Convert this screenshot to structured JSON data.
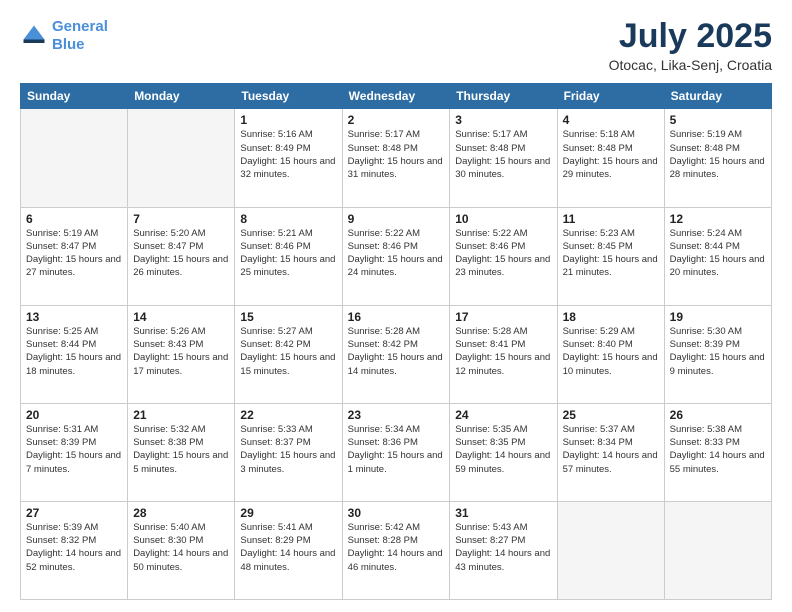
{
  "header": {
    "logo_line1": "General",
    "logo_line2": "Blue",
    "month": "July 2025",
    "location": "Otocac, Lika-Senj, Croatia"
  },
  "weekdays": [
    "Sunday",
    "Monday",
    "Tuesday",
    "Wednesday",
    "Thursday",
    "Friday",
    "Saturday"
  ],
  "weeks": [
    [
      {
        "day": "",
        "sunrise": "",
        "sunset": "",
        "daylight": ""
      },
      {
        "day": "",
        "sunrise": "",
        "sunset": "",
        "daylight": ""
      },
      {
        "day": "1",
        "sunrise": "Sunrise: 5:16 AM",
        "sunset": "Sunset: 8:49 PM",
        "daylight": "Daylight: 15 hours and 32 minutes."
      },
      {
        "day": "2",
        "sunrise": "Sunrise: 5:17 AM",
        "sunset": "Sunset: 8:48 PM",
        "daylight": "Daylight: 15 hours and 31 minutes."
      },
      {
        "day": "3",
        "sunrise": "Sunrise: 5:17 AM",
        "sunset": "Sunset: 8:48 PM",
        "daylight": "Daylight: 15 hours and 30 minutes."
      },
      {
        "day": "4",
        "sunrise": "Sunrise: 5:18 AM",
        "sunset": "Sunset: 8:48 PM",
        "daylight": "Daylight: 15 hours and 29 minutes."
      },
      {
        "day": "5",
        "sunrise": "Sunrise: 5:19 AM",
        "sunset": "Sunset: 8:48 PM",
        "daylight": "Daylight: 15 hours and 28 minutes."
      }
    ],
    [
      {
        "day": "6",
        "sunrise": "Sunrise: 5:19 AM",
        "sunset": "Sunset: 8:47 PM",
        "daylight": "Daylight: 15 hours and 27 minutes."
      },
      {
        "day": "7",
        "sunrise": "Sunrise: 5:20 AM",
        "sunset": "Sunset: 8:47 PM",
        "daylight": "Daylight: 15 hours and 26 minutes."
      },
      {
        "day": "8",
        "sunrise": "Sunrise: 5:21 AM",
        "sunset": "Sunset: 8:46 PM",
        "daylight": "Daylight: 15 hours and 25 minutes."
      },
      {
        "day": "9",
        "sunrise": "Sunrise: 5:22 AM",
        "sunset": "Sunset: 8:46 PM",
        "daylight": "Daylight: 15 hours and 24 minutes."
      },
      {
        "day": "10",
        "sunrise": "Sunrise: 5:22 AM",
        "sunset": "Sunset: 8:46 PM",
        "daylight": "Daylight: 15 hours and 23 minutes."
      },
      {
        "day": "11",
        "sunrise": "Sunrise: 5:23 AM",
        "sunset": "Sunset: 8:45 PM",
        "daylight": "Daylight: 15 hours and 21 minutes."
      },
      {
        "day": "12",
        "sunrise": "Sunrise: 5:24 AM",
        "sunset": "Sunset: 8:44 PM",
        "daylight": "Daylight: 15 hours and 20 minutes."
      }
    ],
    [
      {
        "day": "13",
        "sunrise": "Sunrise: 5:25 AM",
        "sunset": "Sunset: 8:44 PM",
        "daylight": "Daylight: 15 hours and 18 minutes."
      },
      {
        "day": "14",
        "sunrise": "Sunrise: 5:26 AM",
        "sunset": "Sunset: 8:43 PM",
        "daylight": "Daylight: 15 hours and 17 minutes."
      },
      {
        "day": "15",
        "sunrise": "Sunrise: 5:27 AM",
        "sunset": "Sunset: 8:42 PM",
        "daylight": "Daylight: 15 hours and 15 minutes."
      },
      {
        "day": "16",
        "sunrise": "Sunrise: 5:28 AM",
        "sunset": "Sunset: 8:42 PM",
        "daylight": "Daylight: 15 hours and 14 minutes."
      },
      {
        "day": "17",
        "sunrise": "Sunrise: 5:28 AM",
        "sunset": "Sunset: 8:41 PM",
        "daylight": "Daylight: 15 hours and 12 minutes."
      },
      {
        "day": "18",
        "sunrise": "Sunrise: 5:29 AM",
        "sunset": "Sunset: 8:40 PM",
        "daylight": "Daylight: 15 hours and 10 minutes."
      },
      {
        "day": "19",
        "sunrise": "Sunrise: 5:30 AM",
        "sunset": "Sunset: 8:39 PM",
        "daylight": "Daylight: 15 hours and 9 minutes."
      }
    ],
    [
      {
        "day": "20",
        "sunrise": "Sunrise: 5:31 AM",
        "sunset": "Sunset: 8:39 PM",
        "daylight": "Daylight: 15 hours and 7 minutes."
      },
      {
        "day": "21",
        "sunrise": "Sunrise: 5:32 AM",
        "sunset": "Sunset: 8:38 PM",
        "daylight": "Daylight: 15 hours and 5 minutes."
      },
      {
        "day": "22",
        "sunrise": "Sunrise: 5:33 AM",
        "sunset": "Sunset: 8:37 PM",
        "daylight": "Daylight: 15 hours and 3 minutes."
      },
      {
        "day": "23",
        "sunrise": "Sunrise: 5:34 AM",
        "sunset": "Sunset: 8:36 PM",
        "daylight": "Daylight: 15 hours and 1 minute."
      },
      {
        "day": "24",
        "sunrise": "Sunrise: 5:35 AM",
        "sunset": "Sunset: 8:35 PM",
        "daylight": "Daylight: 14 hours and 59 minutes."
      },
      {
        "day": "25",
        "sunrise": "Sunrise: 5:37 AM",
        "sunset": "Sunset: 8:34 PM",
        "daylight": "Daylight: 14 hours and 57 minutes."
      },
      {
        "day": "26",
        "sunrise": "Sunrise: 5:38 AM",
        "sunset": "Sunset: 8:33 PM",
        "daylight": "Daylight: 14 hours and 55 minutes."
      }
    ],
    [
      {
        "day": "27",
        "sunrise": "Sunrise: 5:39 AM",
        "sunset": "Sunset: 8:32 PM",
        "daylight": "Daylight: 14 hours and 52 minutes."
      },
      {
        "day": "28",
        "sunrise": "Sunrise: 5:40 AM",
        "sunset": "Sunset: 8:30 PM",
        "daylight": "Daylight: 14 hours and 50 minutes."
      },
      {
        "day": "29",
        "sunrise": "Sunrise: 5:41 AM",
        "sunset": "Sunset: 8:29 PM",
        "daylight": "Daylight: 14 hours and 48 minutes."
      },
      {
        "day": "30",
        "sunrise": "Sunrise: 5:42 AM",
        "sunset": "Sunset: 8:28 PM",
        "daylight": "Daylight: 14 hours and 46 minutes."
      },
      {
        "day": "31",
        "sunrise": "Sunrise: 5:43 AM",
        "sunset": "Sunset: 8:27 PM",
        "daylight": "Daylight: 14 hours and 43 minutes."
      },
      {
        "day": "",
        "sunrise": "",
        "sunset": "",
        "daylight": ""
      },
      {
        "day": "",
        "sunrise": "",
        "sunset": "",
        "daylight": ""
      }
    ]
  ]
}
